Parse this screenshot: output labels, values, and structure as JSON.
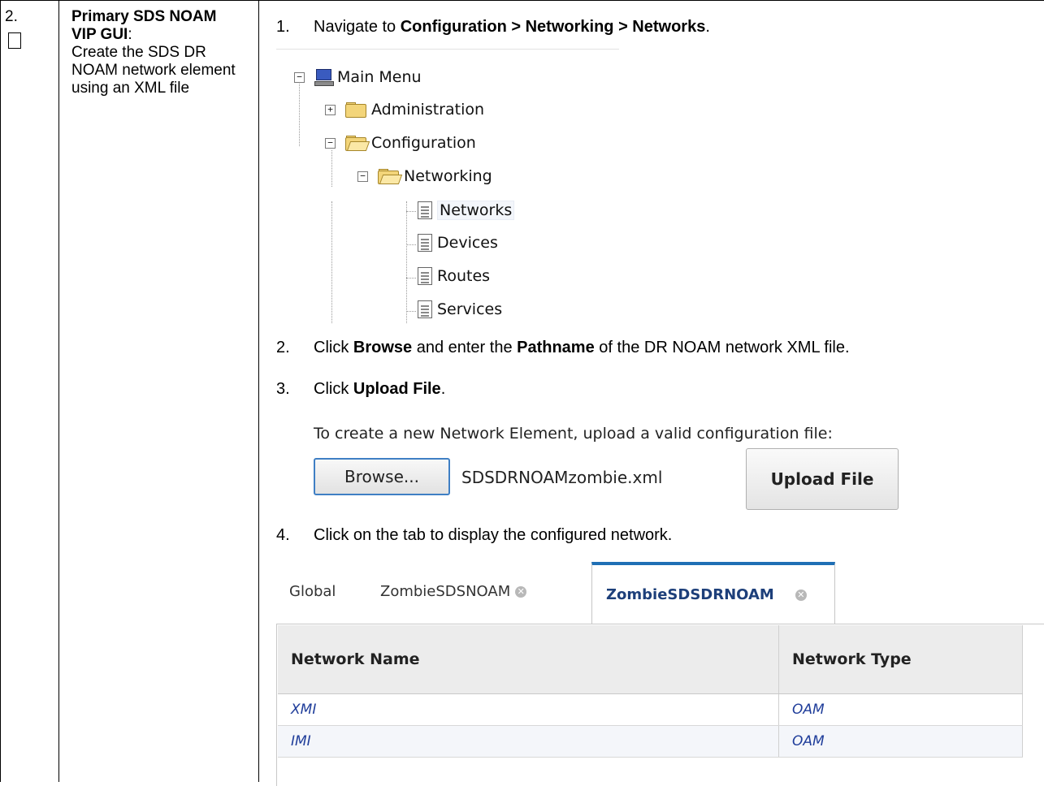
{
  "step": {
    "number": "2.",
    "title_bold": "Primary SDS NOAM VIP GUI",
    "title_colon": ":",
    "title_rest": "Create the SDS DR NOAM network element using an XML file"
  },
  "instructions": [
    {
      "num": "1.",
      "pre": "Navigate to ",
      "bold": "Configuration > Networking > Networks",
      "post": "."
    },
    {
      "num": "2.",
      "pre": "Click ",
      "bold": "Browse",
      "mid": " and enter the ",
      "bold2": "Pathname",
      "post": " of the DR NOAM network XML file."
    },
    {
      "num": "3.",
      "pre": "Click ",
      "bold": "Upload File",
      "post": "."
    },
    {
      "num": "4.",
      "pre": "Click on the tab to display the configured network.",
      "bold": "",
      "post": ""
    }
  ],
  "tree": {
    "root": "Main Menu",
    "administration": "Administration",
    "configuration": "Configuration",
    "networking": "Networking",
    "networks": "Networks",
    "devices": "Devices",
    "routes": "Routes",
    "services": "Services",
    "icons": {
      "root": "computer-icon",
      "folder": "folder-icon",
      "folder_open": "folder-open-icon",
      "page": "document-icon"
    }
  },
  "upload": {
    "prompt": "To create a new Network Element, upload a valid configuration file:",
    "browse_label": "Browse...",
    "file_name": "SDSDRNOAMzombie.xml",
    "upload_label": "Upload File"
  },
  "tabs": {
    "global": "Global",
    "zombie_sdsnoam": "ZombieSDSNOAM",
    "zombie_sdsdrnoam": "ZombieSDSDRNOAM",
    "active": "ZombieSDSDRNOAM",
    "close_glyph": "✕"
  },
  "network_table": {
    "headers": [
      "Network Name",
      "Network Type"
    ],
    "rows": [
      [
        "XMI",
        "OAM"
      ],
      [
        "IMI",
        "OAM"
      ]
    ]
  },
  "colors": {
    "accent_tab": "#1f6fb5",
    "link_text": "#1f3d9a",
    "browse_border": "#3f7fc4"
  }
}
